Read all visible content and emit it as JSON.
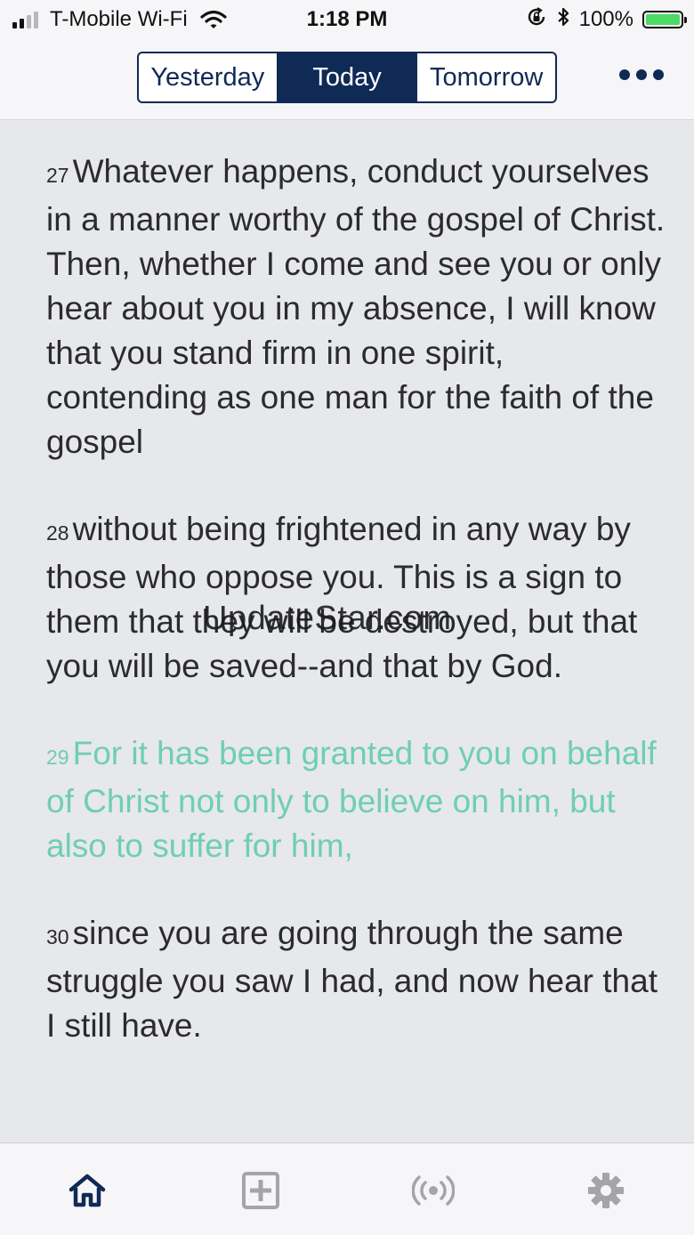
{
  "status_bar": {
    "carrier": "T-Mobile Wi-Fi",
    "time": "1:18 PM",
    "battery": "100%",
    "icons": [
      "signal-icon",
      "wifi-icon",
      "orientation-lock-icon",
      "bluetooth-icon",
      "battery-icon"
    ]
  },
  "nav": {
    "tabs": [
      {
        "label": "Yesterday",
        "active": false
      },
      {
        "label": "Today",
        "active": true
      },
      {
        "label": "Tomorrow",
        "active": false
      }
    ],
    "more_icon": "ellipsis-icon"
  },
  "verses": [
    {
      "number": "27",
      "text": "Whatever happens, conduct yourselves in a manner worthy of the gospel of Christ. Then, whether I come and see you or only hear about you in my absence, I will know that you stand firm in one spirit, contending as one man for the faith of the gospel",
      "highlighted": false
    },
    {
      "number": "28",
      "text": "without being frightened in any way by those who oppose you. This is a sign to them that they will be destroyed, but that you will be saved--and that by God.",
      "highlighted": false
    },
    {
      "number": "29",
      "text": "For it has been granted to you on behalf of Christ not only to believe on him, but also to suffer for him,",
      "highlighted": true
    },
    {
      "number": "30",
      "text": "since you are going through the same struggle you saw I had, and now hear that I still have.",
      "highlighted": false
    }
  ],
  "watermark": "UpdateStar.com",
  "tab_bar": {
    "items": [
      "home-icon",
      "plus-box-icon",
      "broadcast-icon",
      "gear-icon"
    ],
    "active": "home-icon"
  },
  "colors": {
    "navy": "#0f2a55",
    "highlight": "#6fcfae",
    "background": "#e6e8ec",
    "inactive_icon": "#a3a5aa"
  }
}
